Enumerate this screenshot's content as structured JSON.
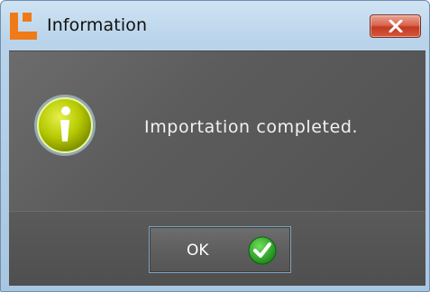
{
  "window": {
    "title": "Information",
    "icons": {
      "logo": "app-logo-icon",
      "close": "close-icon",
      "info": "info-icon",
      "check": "checkmark-icon"
    }
  },
  "dialog": {
    "message": "Importation completed.",
    "ok_label": "OK"
  },
  "colors": {
    "close_button": "#d04a30",
    "info_icon": "#b5c800",
    "check_icon": "#2fa62a",
    "content_bg": "#5e5e5e",
    "frame": "#b9d3ea",
    "logo": "#f07a18"
  }
}
